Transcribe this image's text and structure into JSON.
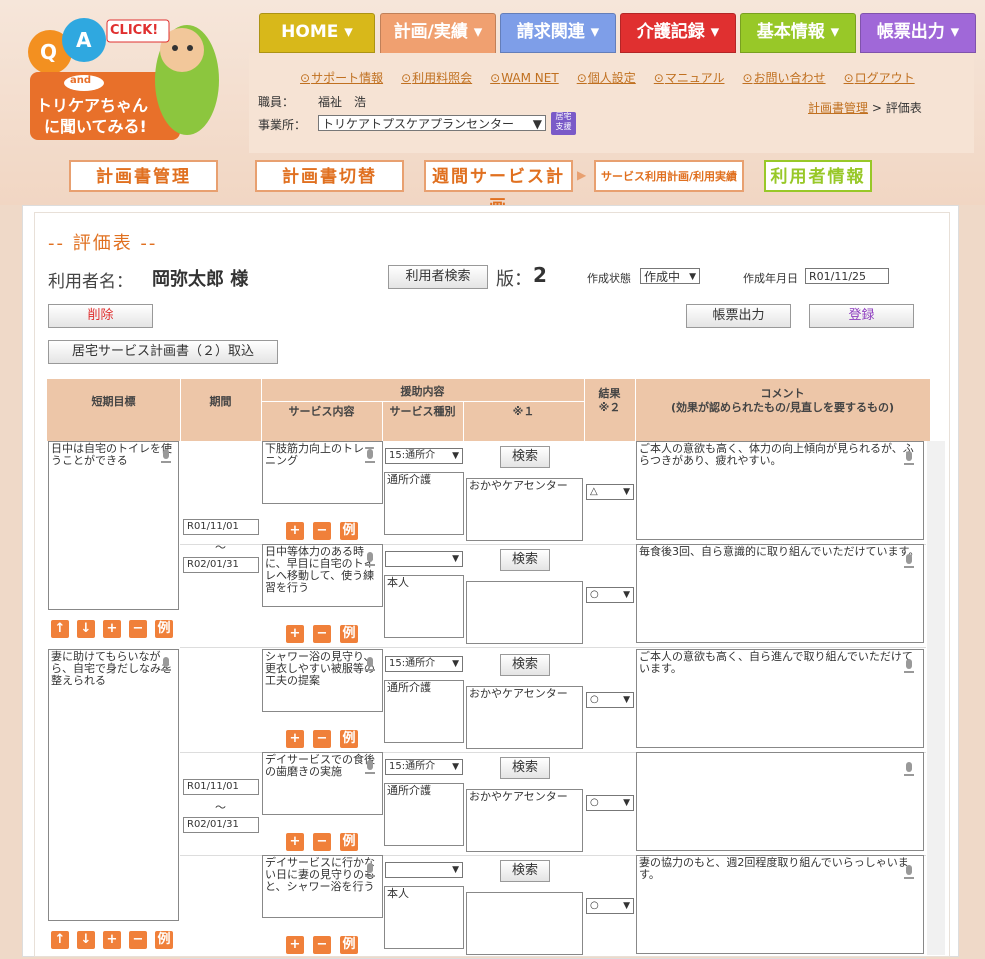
{
  "nav": {
    "home": "HOME",
    "plan": "計画/実績",
    "billing": "請求関連",
    "care": "介護記録",
    "basic": "基本情報",
    "forms": "帳票出力",
    "colors": {
      "home": "#d8b81a",
      "plan": "#f0a070",
      "billing": "#7e9ee8",
      "care": "#e03030",
      "basic": "#98c828",
      "forms": "#a068d8"
    }
  },
  "links": [
    "サポート情報",
    "利用料照会",
    "WAM NET",
    "個人設定",
    "マニュアル",
    "お問い合わせ",
    "ログアウト"
  ],
  "staff_label": "職員：",
  "staff_name": "福祉　浩",
  "office_label": "事業所：",
  "office_value": "トリケアトプスケアプランセンター",
  "office_badge_1": "居宅",
  "office_badge_2": "支援",
  "breadcrumb": {
    "link": "計画書管理",
    "sep": ">",
    "current": "評価表"
  },
  "logo": {
    "q": "Q",
    "a": "A",
    "click": "CLICK!",
    "and": "and",
    "line1": "トリケアちゃん",
    "line2": "に聞いてみる!"
  },
  "top_buttons": [
    "計画書管理",
    "計画書切替",
    "週間サービス計画",
    "サービス利用計画/利用実績",
    "利用者情報"
  ],
  "page_title": "-- 評価表 --",
  "user_label": "利用者名：",
  "user_name": "岡弥太郎 様",
  "user_search": "利用者検索",
  "version_label": "版：",
  "version": "2",
  "status_label": "作成状態",
  "status_value": "作成中",
  "created_label": "作成年月日",
  "created_value": "R01/11/25",
  "delete": "削除",
  "print": "帳票出力",
  "register": "登録",
  "import": "居宅サービス計画書（２）取込",
  "headers": {
    "goal": "短期目標",
    "period": "期間",
    "support": "援助内容",
    "service": "サービス内容",
    "type": "サービス種別",
    "note1": "※１",
    "result": "結果",
    "note2": "※２",
    "comment": "コメント",
    "comment_sub": "(効果が認められたもの/見直しを要するもの)"
  },
  "search_label": "検索",
  "example_label": "例",
  "tilde": "～",
  "rows": [
    {
      "goal": "日中は自宅のトイレを使うことができる",
      "start": "R01/11/01",
      "end": "R02/01/31",
      "items": [
        {
          "service": "下肢筋力向上のトレーニング",
          "sel": "15:通所介",
          "type": "通所介護",
          "provider": "おかやケアセンター",
          "result": "△",
          "comment": "ご本人の意欲も高く、体力の向上傾向が見られるが、ふらつきがあり、疲れやすい。"
        },
        {
          "service": "日中等体力のある時に、早目に自宅のトイレへ移動して、使う練習を行う",
          "sel": "",
          "type": "本人",
          "provider": "",
          "result": "○",
          "comment": "毎食後3回、自ら意識的に取り組んでいただけています。"
        }
      ]
    },
    {
      "goal": "妻に助けてもらいながら、自宅で身だしなみを整えられる",
      "start": "R01/11/01",
      "end": "R02/01/31",
      "items": [
        {
          "service": "シャワー浴の見守り、更衣しやすい被服等の工夫の提案",
          "sel": "15:通所介",
          "type": "通所介護",
          "provider": "おかやケアセンター",
          "result": "○",
          "comment": "ご本人の意欲も高く、自ら進んで取り組んでいただけています。"
        },
        {
          "service": "デイサービスでの食後の歯磨きの実施",
          "sel": "15:通所介",
          "type": "通所介護",
          "provider": "おかやケアセンター",
          "result": "○",
          "comment": ""
        },
        {
          "service": "デイサービスに行かない日に妻の見守りのもと、シャワー浴を行う",
          "sel": "",
          "type": "本人",
          "provider": "",
          "result": "○",
          "comment": "妻の協力のもと、週2回程度取り組んでいらっしゃいます。"
        }
      ]
    }
  ]
}
